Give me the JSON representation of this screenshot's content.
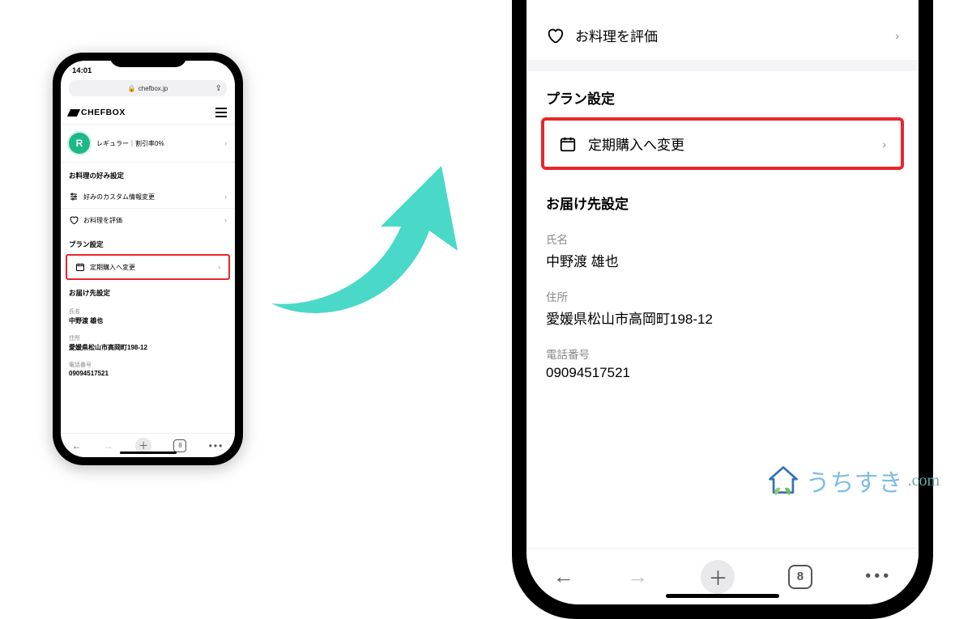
{
  "small_phone": {
    "time": "14:01",
    "url": "chefbox.jp",
    "brand": "CHEFBOX",
    "avatar_letter": "R",
    "regular_label": "レギュラー｜割引率0%",
    "section_food": "お料理の好み設定",
    "row_custom": "好みのカスタム情報変更",
    "row_review": "お料理を評価",
    "section_plan": "プラン設定",
    "row_plan_change": "定期購入へ変更",
    "section_addr": "お届け先設定",
    "name_label": "氏名",
    "name_value": "中野渡 雄也",
    "addr_label": "住所",
    "addr_value": "愛媛県松山市高岡町198-12",
    "tel_label": "電話番号",
    "tel_value": "09094517521",
    "tab_count": "8"
  },
  "large_phone": {
    "row_review": "お料理を評価",
    "section_plan": "プラン設定",
    "row_plan_change": "定期購入へ変更",
    "section_addr": "お届け先設定",
    "name_label": "氏名",
    "name_value": "中野渡 雄也",
    "addr_label": "住所",
    "addr_value": "愛媛県松山市高岡町198-12",
    "tel_label": "電話番号",
    "tel_value": "09094517521",
    "tab_count": "8"
  },
  "watermark": {
    "text": "うちすき",
    "suffix": ".com"
  }
}
